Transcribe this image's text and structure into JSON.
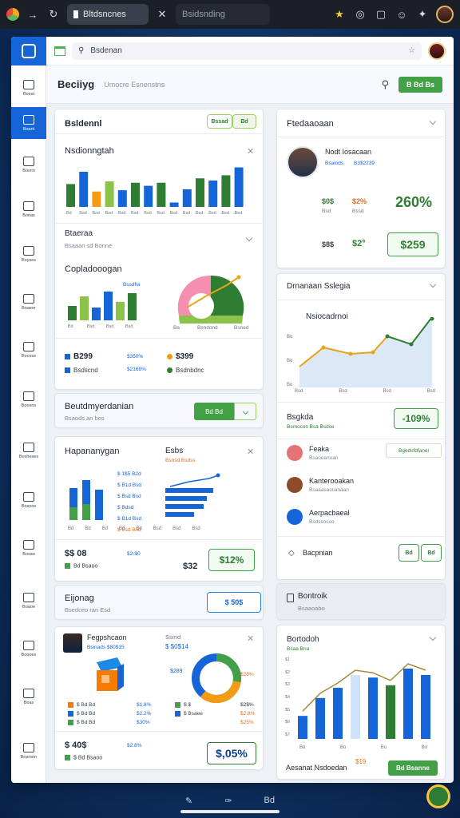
{
  "browser": {
    "tab_active": "Bltdsncnes",
    "tab_inactive": "Bsidsnding"
  },
  "address": {
    "text": "Bsdenan"
  },
  "page": {
    "title": "Beciiyg",
    "subtitle": "Umocre Esnenstns",
    "action": "B Bd Bs"
  },
  "sidebar": {
    "items": [
      {
        "label": "Bocet",
        "icon": "home-icon"
      },
      {
        "label": "Boant",
        "icon": "chart-icon"
      },
      {
        "label": "Bosnn",
        "icon": "folder-icon"
      },
      {
        "label": "Bonas",
        "icon": "house-icon"
      },
      {
        "label": "Boyses",
        "icon": "trend-icon"
      },
      {
        "label": "Boaeer",
        "icon": "leaf-icon"
      },
      {
        "label": "Bocess",
        "icon": "team-icon"
      },
      {
        "label": "Boosns",
        "icon": "clock-icon"
      },
      {
        "label": "Bosheses",
        "icon": "doc-icon"
      },
      {
        "label": "Bosoos",
        "icon": "leaf2-icon"
      },
      {
        "label": "Bosao",
        "icon": "note-icon"
      },
      {
        "label": "Boaoe",
        "icon": "timer-icon"
      },
      {
        "label": "Boooes",
        "icon": "mail-icon"
      },
      {
        "label": "Boas",
        "icon": "grid-icon"
      },
      {
        "label": "Boarsnn",
        "icon": "badge-icon"
      }
    ]
  },
  "card_stats": {
    "title": "Bsldennl",
    "bar_title": "Nsdionngtah",
    "tabs": [
      "Bssad",
      "Bd"
    ],
    "xlabels": [
      "Bd",
      "Bsd",
      "Bsd",
      "Bsd",
      "Bsd",
      "Bsd",
      "Bsd",
      "Bsd",
      "Bsd",
      "Bsd",
      "Bsd",
      "Bsd",
      "Bsd",
      "Bsd"
    ],
    "heights_pct": [
      52,
      80,
      35,
      58,
      38,
      55,
      48,
      55,
      10,
      40,
      65,
      60,
      72,
      90
    ],
    "colors": [
      "#2e7d32",
      "#1565d8",
      "#f39c12",
      "#8bc34a",
      "#1565d8",
      "#2e7d32",
      "#1565d8",
      "#2e7d32",
      "#1565d8",
      "#1565d8",
      "#2e7d32",
      "#1565d8",
      "#2e7d32",
      "#1565d8"
    ],
    "section2": "Btaeraa",
    "section2_sub": "Bsaaan sd Bonne",
    "compare_title": "Copladooogan",
    "compare_legend": "Bssdfla",
    "compare_vals": [
      45,
      75,
      40,
      90,
      58,
      85
    ],
    "compare_colors": [
      "#2e7d32",
      "#8bc34a",
      "#1565d8",
      "#1565d8",
      "#8bc34a",
      "#2e7d32"
    ],
    "compare_xlabels": [
      "Bd",
      "Bsd",
      "Bsd",
      "Bsd"
    ],
    "pie_labels": [
      "Ba",
      "Bsndond",
      "Bsned"
    ],
    "kpi1": "B299",
    "kpi1_label": "Bsdscnd",
    "kpi1_val": "$350%",
    "kpi1_val2": "$2169%",
    "kpi2": "$399",
    "kpi2_label": "Bsdnbdnc"
  },
  "card_profile": {
    "title": "Ftedaaoaan",
    "name": "Nodt Iosacaan",
    "tag1": "Bsaiods",
    "tag2": "B3$2239",
    "s1": "$0$",
    "s1_label": "Bsd",
    "s2": "$2%",
    "s2_label": "Bssd",
    "s3": "260%",
    "s4": "$8$",
    "s5": "$2°",
    "box": "$259"
  },
  "card_sales": {
    "title": "Drnanaan Sslegia",
    "chart_title": "Nsiocadrnoi",
    "ylabels": [
      "Bo",
      "Bo",
      "Bo"
    ],
    "xlabels": [
      "Bsd",
      "Bsd",
      "Bsd",
      "Bsd"
    ],
    "metric_title": "Bsgkda",
    "metric_sub": "Bsmocos Bsa Bsdse",
    "metric_val": "-109%",
    "list": [
      {
        "title": "Feaka",
        "sub": "Bsaoeanoan"
      },
      {
        "title": "Kanterooakan",
        "sub": "Bsaaasaoiianaan"
      },
      {
        "title": "Aerpacbaeal",
        "sub": "Bsdssocco"
      }
    ],
    "list_action": "Bgedsfdfanel",
    "footer_label": "Bacpnian",
    "footer_pill": [
      "Bd",
      "Bd"
    ]
  },
  "card_report": {
    "title": "Beutdmyerdanian",
    "sub": "Bsaods an bos",
    "btn": "Bd Bd"
  },
  "card_hist": {
    "title": "Hapananygan",
    "sub_title": "Esbs",
    "sub_tag": "Bsnsd Bsdss",
    "legend": [
      "$ 1$5 B2d",
      "$ B1d Bsd",
      "$ Bsd Bsd"
    ],
    "legend2": [
      "$ Bdsd",
      "$ B1d Bsd",
      "$ Bsd Bsd"
    ],
    "xlabels": [
      "Bd",
      "Bd",
      "Bd",
      "Bd",
      "Bd",
      "Bsd",
      "Bsd",
      "Bsd"
    ],
    "kpi": "$$ 08",
    "kpi_sub": "Bd Bsaoo",
    "kpi_mid": "$2-$0",
    "kpi_val": "$32",
    "pill": "$12%"
  },
  "card_bottom_left": {
    "title": "Eijonag",
    "sub": "Bsedceo ran Esd",
    "btn": "$ 50$",
    "person": "Fegpshcaon",
    "person_sub": "Bsinads $80$15",
    "metric": "Ssmd",
    "metric_val": "$ $0$14",
    "left_vals": [
      "$289"
    ],
    "legend1": [
      "$ Bd Bd",
      "$ Bd Bd",
      "$ Bd Bd"
    ],
    "legend1_vals": [
      "$1.8%",
      "$2.2%",
      "$30%"
    ],
    "legend2": [
      "$ $",
      "$ Bsaee",
      "$ Bsdaaee"
    ],
    "legend2_vals": [
      "$2$%",
      "$2.8%",
      "$25%"
    ],
    "donut_label": "$28%",
    "kpi": "$ 40$",
    "kpi_sub": "$ Bd Bsaoo",
    "kpi_mid": "$2.8%",
    "pill": "$,05%"
  },
  "card_bottom_right": {
    "title": "Bontroik",
    "sub": "Bsaaoabo",
    "chart_title": "Bortodoh",
    "chart_sub": "Bsaa Bna",
    "bar_heights": [
      18,
      32,
      40,
      50,
      48,
      42,
      55,
      50
    ],
    "bar_colors": [
      "#1565d8",
      "#1565d8",
      "#1565d8",
      "#cfe3fb",
      "#1565d8",
      "#2e7d32",
      "#1565d8",
      "#1565d8"
    ],
    "xlabels": [
      "Bo",
      "Bo",
      "Bo",
      "Bo"
    ],
    "ylabels": [
      "$1",
      "$2",
      "$3",
      "$4",
      "$5",
      "$6",
      "$7"
    ],
    "foot_val": "$19",
    "foot_title": "Aesanat Nsdoedan",
    "foot_btn": "Bd Bsanne"
  },
  "bottom_nav": [
    "Bd"
  ]
}
